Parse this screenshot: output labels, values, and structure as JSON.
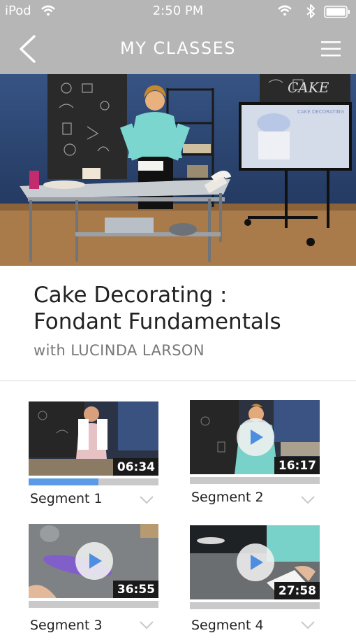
{
  "status_bar": {
    "carrier": "iPod",
    "time": "2:50 PM"
  },
  "nav": {
    "title": "MY CLASSES"
  },
  "class": {
    "title_line1": "Cake Decorating :",
    "title_line2": "Fondant  Fundamentals",
    "instructor": "with LUCINDA LARSON"
  },
  "segments": [
    {
      "label": "Segment 1",
      "duration": "06:34",
      "state": "paused",
      "progress": 0.54
    },
    {
      "label": "Segment 2",
      "duration": "16:17",
      "state": "play",
      "progress": 0
    },
    {
      "label": "Segment 3",
      "duration": "36:55",
      "state": "play",
      "progress": 0
    },
    {
      "label": "Segment 4",
      "duration": "27:58",
      "state": "play",
      "progress": 0
    }
  ],
  "colors": {
    "bar_gray": "#b6b6b6",
    "progress_blue": "#5b9ae6",
    "track_gray": "#c9c9c9"
  }
}
